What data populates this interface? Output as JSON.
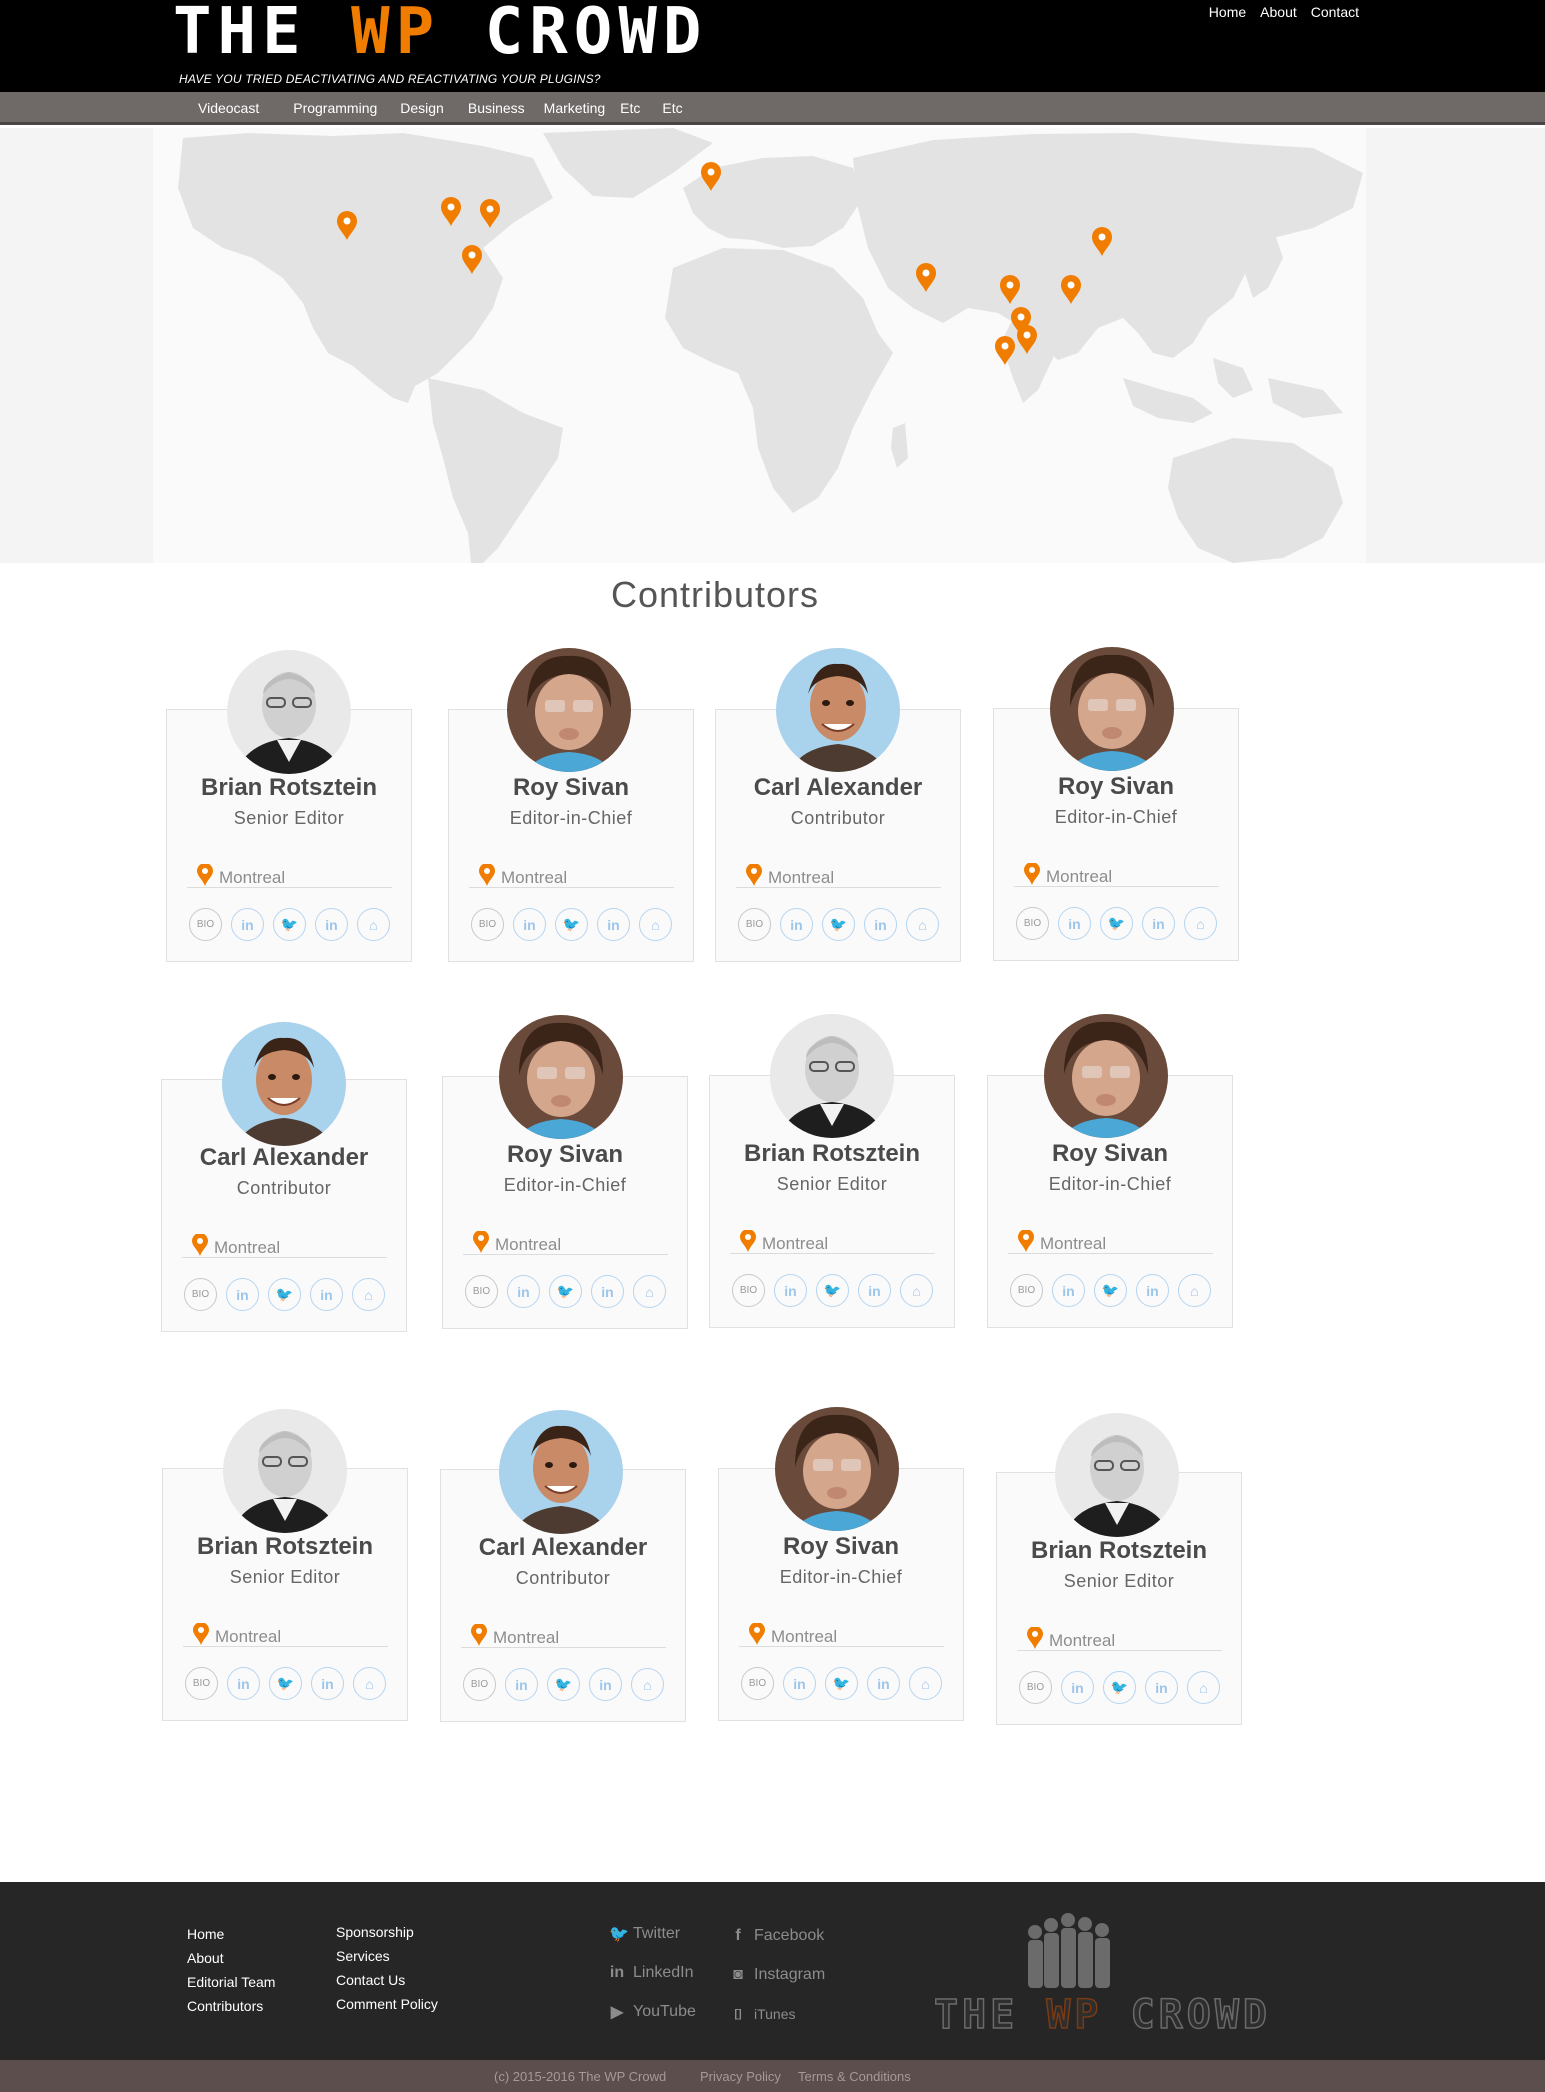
{
  "brand": {
    "logo_the": "THE ",
    "logo_wp": "WP",
    "logo_crowd": " CROWD",
    "tagline": "HAVE YOU TRIED DEACTIVATING AND REACTIVATING  YOUR PLUGINS?",
    "accent_color": "#f07c00"
  },
  "top_nav": [
    "Home",
    "About",
    "Contact"
  ],
  "menu": [
    "Videocast",
    "Programming",
    "Design",
    "Business",
    "Marketing",
    "Etc",
    "Etc"
  ],
  "map": {
    "marker_color": "#f07c00",
    "marker_count": 12
  },
  "contributors": {
    "title": "Contributors",
    "people": [
      {
        "name": "Brian Rotsztein",
        "role": "Senior Editor",
        "location": "Montreal",
        "avatar": "brian"
      },
      {
        "name": "Roy Sivan",
        "role": "Editor-in-Chief",
        "location": "Montreal",
        "avatar": "roy"
      },
      {
        "name": "Carl Alexander",
        "role": "Contributor",
        "location": "Montreal",
        "avatar": "carl"
      },
      {
        "name": "Roy Sivan",
        "role": "Editor-in-Chief",
        "location": "Montreal",
        "avatar": "roy"
      },
      {
        "name": "Carl Alexander",
        "role": "Contributor",
        "location": "Montreal",
        "avatar": "carl"
      },
      {
        "name": "Roy Sivan",
        "role": "Editor-in-Chief",
        "location": "Montreal",
        "avatar": "roy"
      },
      {
        "name": "Brian Rotsztein",
        "role": "Senior Editor",
        "location": "Montreal",
        "avatar": "brian"
      },
      {
        "name": "Roy Sivan",
        "role": "Editor-in-Chief",
        "location": "Montreal",
        "avatar": "roy"
      },
      {
        "name": "Brian Rotsztein",
        "role": "Senior Editor",
        "location": "Montreal",
        "avatar": "brian"
      },
      {
        "name": "Carl Alexander",
        "role": "Contributor",
        "location": "Montreal",
        "avatar": "carl"
      },
      {
        "name": "Roy Sivan",
        "role": "Editor-in-Chief",
        "location": "Montreal",
        "avatar": "roy"
      },
      {
        "name": "Brian Rotsztein",
        "role": "Senior Editor",
        "location": "Montreal",
        "avatar": "brian"
      }
    ],
    "social_buttons": [
      {
        "label": "BIO",
        "icon": "bio-icon"
      },
      {
        "label": "in",
        "icon": "linkedin-icon"
      },
      {
        "label": "🐦",
        "icon": "twitter-icon"
      },
      {
        "label": "in",
        "icon": "linkedin-icon"
      },
      {
        "label": "⌂",
        "icon": "home-icon"
      }
    ]
  },
  "footer": {
    "col1": [
      "Home",
      "About",
      "Editorial Team",
      "Contributors"
    ],
    "col2": [
      "Sponsorship",
      "Services",
      "Contact Us",
      "Comment Policy"
    ],
    "social_left": [
      {
        "label": "Twitter",
        "icon": "twitter-icon",
        "glyph": "🐦"
      },
      {
        "label": "LinkedIn",
        "icon": "linkedin-icon",
        "glyph": "in"
      },
      {
        "label": "YouTube",
        "icon": "youtube-icon",
        "glyph": "▶"
      }
    ],
    "social_right": [
      {
        "label": "Facebook",
        "icon": "facebook-icon",
        "glyph": "f"
      },
      {
        "label": "Instagram",
        "icon": "instagram-icon",
        "glyph": "◙"
      },
      {
        "label": "iTunes",
        "icon": "itunes-icon",
        "glyph": "[]"
      }
    ],
    "logo_the": "THE ",
    "logo_wp": "WP",
    "logo_crowd": " CROWD"
  },
  "copyright": {
    "text": "(c) 2015-2016 The WP Crowd",
    "privacy": "Privacy Policy",
    "terms": "Terms & Conditions"
  }
}
